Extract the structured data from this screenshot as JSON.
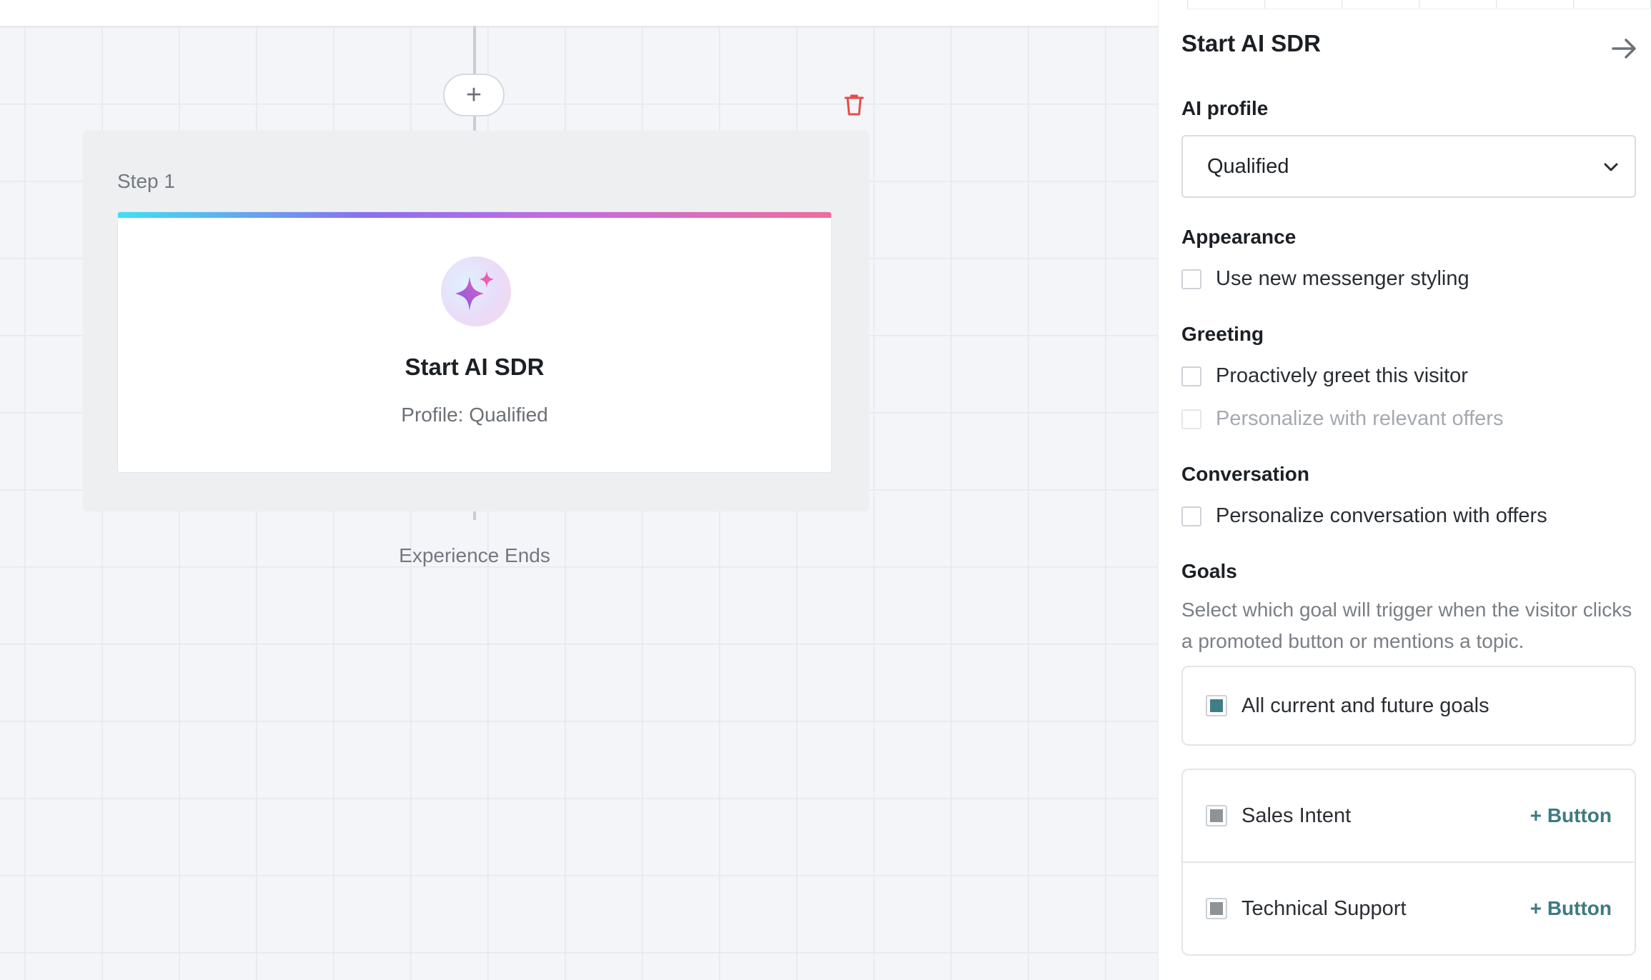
{
  "colors": {
    "accent": "#3d7a82",
    "checked_primary": "#3f7e88",
    "checked_secondary": "#8d9396",
    "delete": "#e84b4b"
  },
  "canvas": {
    "add_step_symbol": "+",
    "step": {
      "label": "Step 1",
      "card": {
        "icon": "sparkles-icon",
        "title": "Start AI SDR",
        "subtitle": "Profile: Qualified"
      }
    },
    "end_label": "Experience Ends"
  },
  "panel": {
    "title": "Start AI SDR",
    "close_icon": "arrow-right-icon",
    "ai_profile": {
      "heading": "AI profile",
      "selected": "Qualified"
    },
    "appearance": {
      "heading": "Appearance",
      "options": [
        {
          "label": "Use new messenger styling",
          "checked": false
        }
      ]
    },
    "greeting": {
      "heading": "Greeting",
      "options": [
        {
          "label": "Proactively greet this visitor",
          "checked": false,
          "disabled": false
        },
        {
          "label": "Personalize with relevant offers",
          "checked": false,
          "disabled": true
        }
      ]
    },
    "conversation": {
      "heading": "Conversation",
      "options": [
        {
          "label": "Personalize conversation with offers",
          "checked": false
        }
      ]
    },
    "goals": {
      "heading": "Goals",
      "help": "Select which goal will trigger when the visitor clicks a promoted button or mentions a topic.",
      "all_goals": {
        "label": "All current and future goals",
        "checked": true
      },
      "items": [
        {
          "label": "Sales Intent",
          "checked": true,
          "action": "+ Button"
        },
        {
          "label": "Technical Support",
          "checked": true,
          "action": "+ Button"
        }
      ]
    }
  }
}
